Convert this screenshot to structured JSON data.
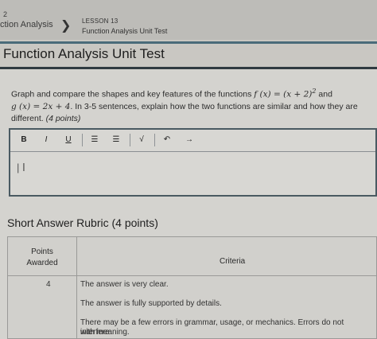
{
  "breadcrumb": {
    "previous_number": "2",
    "previous_label": "ction Analysis",
    "separator": "❯",
    "lesson_label": "LESSON 13",
    "current_label": "Function Analysis Unit Test"
  },
  "page": {
    "title": "Function Analysis Unit Test"
  },
  "question": {
    "line1_prefix": "Graph and compare the shapes and key features of the functions ",
    "f_expr": "f (x) = (x + 2)",
    "f_exp": "2",
    "line1_suffix": " and",
    "g_expr": "g (x) = 2x + 4",
    "line2_rest": ". In 3-5 sentences, explain how the two functions are similar and how they are",
    "line3": "different.",
    "points": "(4 points)"
  },
  "editor": {
    "toolbar": {
      "bold": "B",
      "italic": "I",
      "underline": "U",
      "align_left": "☰",
      "align_right": "☰",
      "sqrt": "√",
      "undo": "↶",
      "redo": "→"
    },
    "value": ""
  },
  "rubric": {
    "title": "Short Answer Rubric (4 points)",
    "header_points_line1": "Points",
    "header_points_line2": "Awarded",
    "header_criteria": "Criteria",
    "rows": [
      {
        "points": "4",
        "criteria": [
          "The answer is very clear.",
          "The answer is fully supported by details.",
          "There may be a few errors in grammar, usage, or mechanics. Errors do not interfere",
          "with meaning."
        ]
      }
    ]
  }
}
